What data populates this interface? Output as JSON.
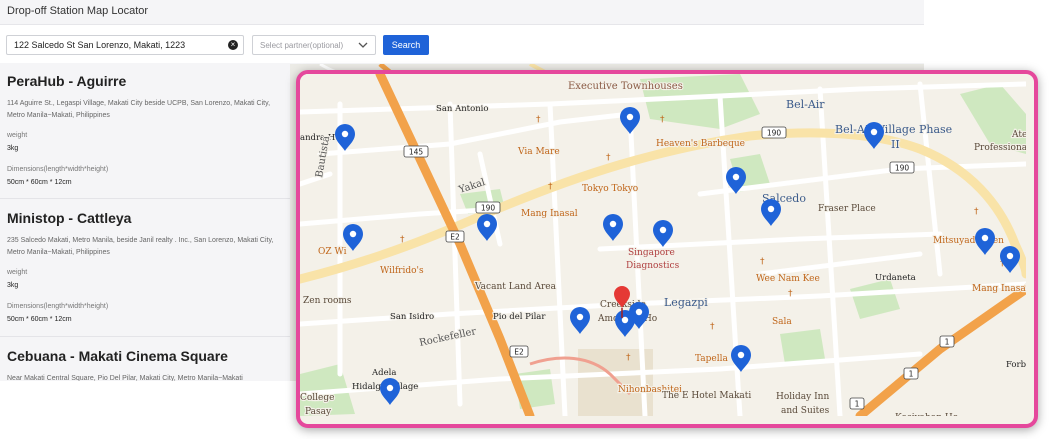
{
  "app": {
    "title": "Drop-off Station Map Locator"
  },
  "search": {
    "address_value": "122 Salcedo St San Lorenzo, Makati, 1223",
    "partner_placeholder": "Select partner(optional)",
    "button_label": "Search",
    "clear_icon": "close-circle-icon",
    "dropdown_icon": "chevron-down-icon"
  },
  "results": [
    {
      "name": "PeraHub - Aguirre",
      "address": "114 Aguirre St., Legaspi Village, Makati City beside UCPB, San Lorenzo, Makati City, Metro Manila~Makati, Philippines",
      "weight_label": "weight",
      "weight": "3kg",
      "dimensions_label": "Dimensions(length*width*height)",
      "dimensions": "50cm * 60cm * 12cm"
    },
    {
      "name": "Ministop - Cattleya",
      "address": "235 Salcedo Makati, Metro Manila, beside Janil realty . Inc., San Lorenzo, Makati City, Metro Manila~Makati, Philippines",
      "weight_label": "weight",
      "weight": "3kg",
      "dimensions_label": "Dimensions(length*width*height)",
      "dimensions": "50cm * 60cm * 12cm"
    },
    {
      "name": "Cebuana - Makati Cinema Square",
      "address": "Near Makati Central Square, Pio Del Pilar, Makati City, Metro Manila~Makati"
    }
  ],
  "map": {
    "colors": {
      "land": "#f4f1e9",
      "park": "#cfe8c0",
      "expressway": "#f2a24a",
      "arterial": "#f9e3a8",
      "road": "#ffffff",
      "marker": "#1f63d8",
      "current_location": "#e53935"
    },
    "labels": [
      {
        "text": "Executive Townhouses",
        "cls": "area"
      },
      {
        "text": "Bel-Air",
        "cls": "district"
      },
      {
        "text": "Bel-Air Village Phase",
        "cls": "district"
      },
      {
        "text": "II",
        "cls": "district"
      },
      {
        "text": "Ateneo",
        "cls": "poi"
      },
      {
        "text": "Professional S",
        "cls": "poi"
      },
      {
        "text": "San Antonio",
        "cls": "place"
      },
      {
        "text": "andra Hu",
        "cls": "place"
      },
      {
        "text": "Via Mare",
        "cls": "food"
      },
      {
        "text": "Heaven's Barbeque",
        "cls": "food"
      },
      {
        "text": "Bautista",
        "cls": "street"
      },
      {
        "text": "Yakal",
        "cls": "street"
      },
      {
        "text": "Tokyo Tokyo",
        "cls": "food"
      },
      {
        "text": "Salcedo",
        "cls": "district"
      },
      {
        "text": "Fraser Place",
        "cls": "poi"
      },
      {
        "text": "Mang Inasal",
        "cls": "food"
      },
      {
        "text": "OZ Wi",
        "cls": "food"
      },
      {
        "text": "Singapore",
        "cls": "health"
      },
      {
        "text": "Diagnostics",
        "cls": "health"
      },
      {
        "text": "Mitsuyado Men",
        "cls": "food"
      },
      {
        "text": "Wilfrido's",
        "cls": "food"
      },
      {
        "text": "Wee Nam Kee",
        "cls": "food"
      },
      {
        "text": "Urdaneta",
        "cls": "place"
      },
      {
        "text": "Mang Inasal",
        "cls": "food"
      },
      {
        "text": "Vacant Land Area",
        "cls": "poi"
      },
      {
        "text": "Legazpi",
        "cls": "district"
      },
      {
        "text": "Zen rooms",
        "cls": "poi"
      },
      {
        "text": "Creekside",
        "cls": "poi"
      },
      {
        "text": "Amorsolo Ho",
        "cls": "poi"
      },
      {
        "text": "Sala",
        "cls": "food"
      },
      {
        "text": "San Isidro",
        "cls": "place"
      },
      {
        "text": "Pio del Pilar",
        "cls": "place"
      },
      {
        "text": "Rockefeller",
        "cls": "street"
      },
      {
        "text": "Tapella",
        "cls": "food"
      },
      {
        "text": "Forb",
        "cls": "place"
      },
      {
        "text": "Adela",
        "cls": "place"
      },
      {
        "text": "Hidalgo Village",
        "cls": "place"
      },
      {
        "text": "Nihonbashitei",
        "cls": "food"
      },
      {
        "text": "The E Hotel Makati",
        "cls": "poi"
      },
      {
        "text": "Holiday Inn",
        "cls": "poi"
      },
      {
        "text": "and Suites",
        "cls": "poi"
      },
      {
        "text": "Kasiyahan Ho",
        "cls": "poi"
      },
      {
        "text": "College",
        "cls": "poi"
      },
      {
        "text": "Pasay",
        "cls": "poi"
      },
      {
        "text": "Avitel",
        "cls": "poi"
      }
    ],
    "road_shields": [
      "145",
      "190",
      "190",
      "190",
      "E2",
      "E2",
      "1",
      "1",
      "1"
    ]
  }
}
